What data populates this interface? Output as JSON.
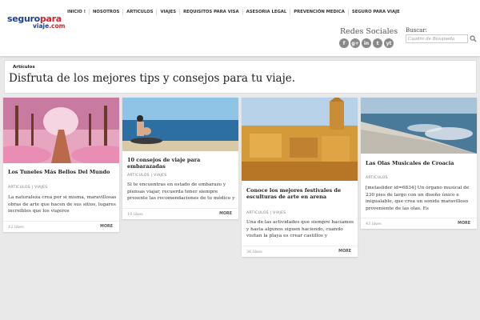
{
  "logo": {
    "part1": "seguro",
    "part2": "para",
    "part3": "viaje",
    "part4": ".com"
  },
  "nav": [
    "INICIO !",
    "NOSOTROS",
    "ARTICULOS",
    "VIAJES",
    "REQUISITOS PARA VISA",
    "ASESORIA LEGAL",
    "PREVENCIÓN MEDICA",
    "SEGURO PARA VIAJE"
  ],
  "social": {
    "title": "Redes Sociales",
    "icons": [
      "f",
      "g+",
      "in",
      "t",
      "yt"
    ]
  },
  "search": {
    "label": "Buscar:",
    "placeholder": "Cuadro de Búsqueda"
  },
  "hero": {
    "breadcrumb": "Artículos",
    "heading": "Disfruta de los mejores tips y consejos para tu viaje."
  },
  "cards": [
    {
      "title": "Los Tuneles Más Bellos Del Mundo",
      "category": "ARTICULOS | VIAJES",
      "excerpt": "La naturaleza crea por si misma, maravillosas obras de arte que hacen de sus sitios, lugares increibles que los viajeros",
      "likes": "12 likes",
      "more": "MORE"
    },
    {
      "title": "10 consejos de viaje para embarazadas",
      "category": "ARTICULOS | VIAJES",
      "excerpt": "Si te encuentras en estado de embarazo y piensas viajar, recuerda tener siempre presente las recomendaciones de tu médico y",
      "likes": "10 likes",
      "more": "MORE"
    },
    {
      "title": "Conoce los mejores festivales de esculturas de arte en arena",
      "category": "ARTICULOS | VIAJES",
      "excerpt": "Una de las actividades que siempre hacíamos y hasta algunos siguen haciendo, cuando visitan la playa es crear castillos y",
      "likes": "36 likes",
      "more": "MORE"
    },
    {
      "title": "Las Olas Musicales de Croacia",
      "category": "ARTICULOS",
      "excerpt": "[metaslider id=6834] Un órgano musical de 230 pies de largo con un diseño único e inigualable, que crea un sonido maravilloso proveniente de las olas. Es",
      "likes": "43 likes",
      "more": "MORE"
    }
  ]
}
